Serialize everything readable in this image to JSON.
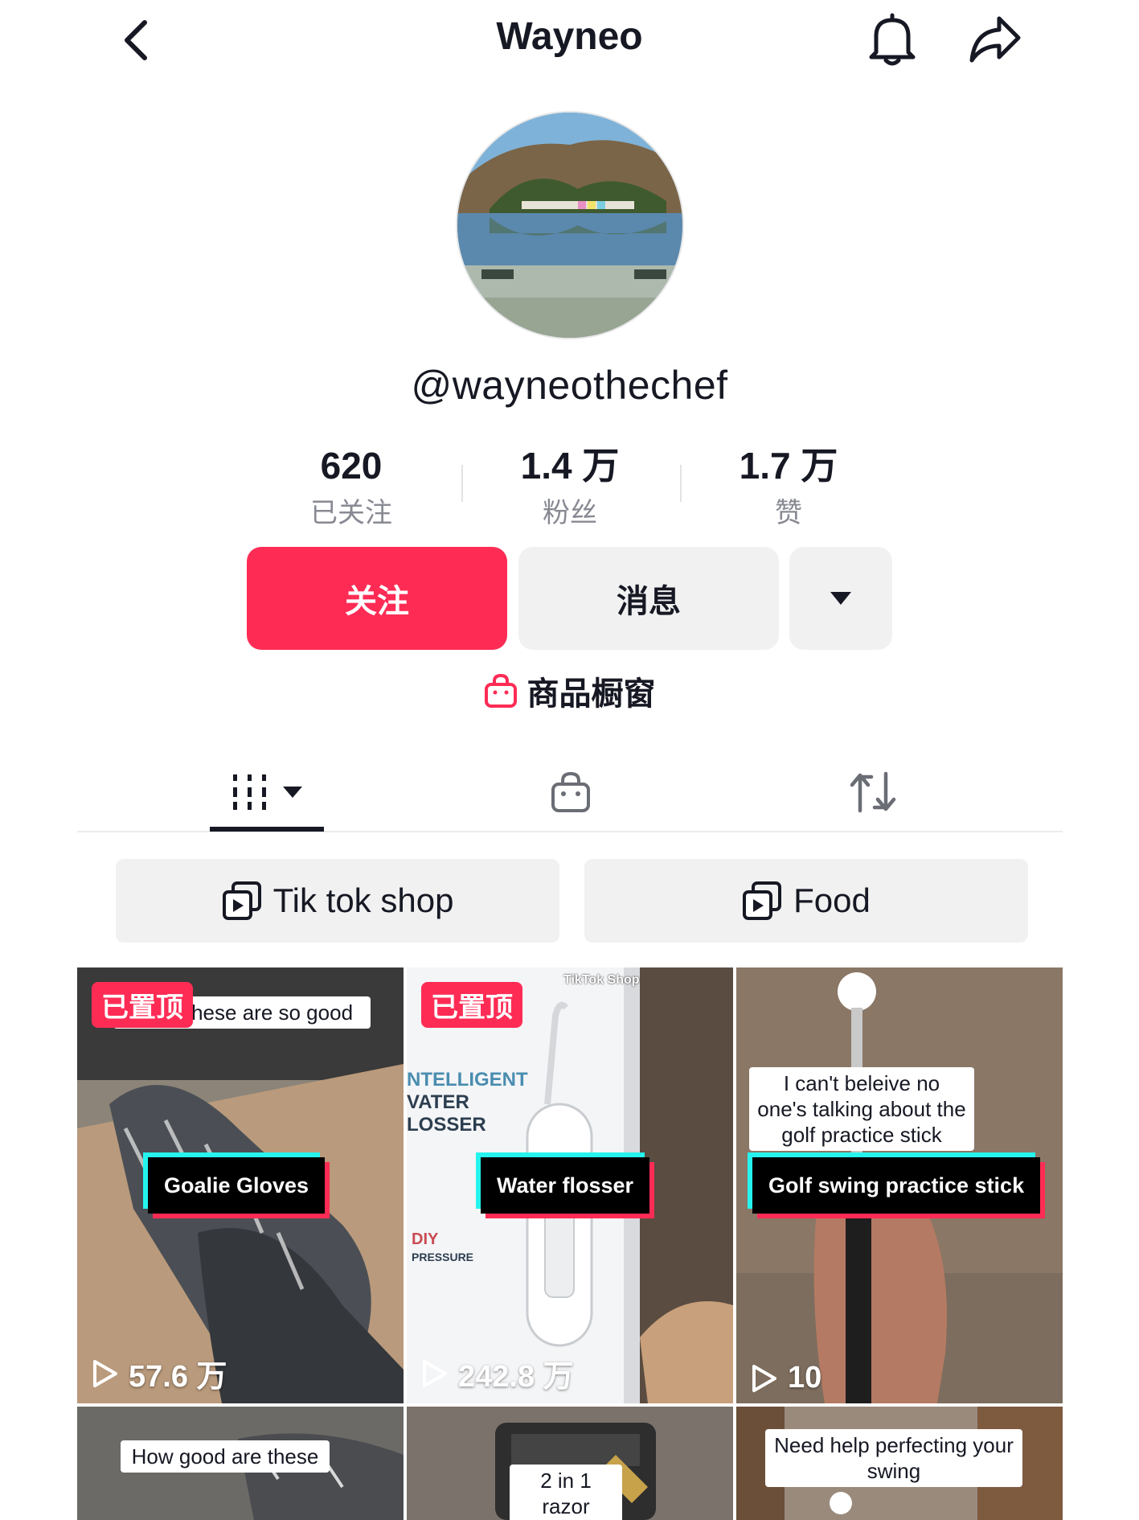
{
  "header": {
    "title": "Wayneo",
    "back_icon": "chevron-left-icon",
    "bell_icon": "bell-icon",
    "share_icon": "share-icon"
  },
  "profile": {
    "handle": "@wayneothechef",
    "stats": [
      {
        "value": "620",
        "label": "已关注"
      },
      {
        "value": "1.4 万",
        "label": "粉丝"
      },
      {
        "value": "1.7 万",
        "label": "赞"
      }
    ]
  },
  "actions": {
    "follow_label": "关注",
    "message_label": "消息"
  },
  "showcase": {
    "label": "商品橱窗"
  },
  "tabs": [
    {
      "name": "videos",
      "icon": "grid-icon",
      "active": true
    },
    {
      "name": "shop",
      "icon": "bag-icon",
      "active": false
    },
    {
      "name": "reposts",
      "icon": "repost-icon",
      "active": false
    }
  ],
  "playlists": [
    {
      "label": "Tik tok shop"
    },
    {
      "label": "Food"
    }
  ],
  "videos": [
    {
      "pinned_label": "已置顶",
      "caption_top": "loves these are so good",
      "title": "Goalie Gloves",
      "views": "57.6 万"
    },
    {
      "pinned_label": "已置顶",
      "overlay_brand": "TikTok Shop",
      "box_text_1": "NTELLIGENT",
      "box_text_2": "VATER",
      "box_text_3": "LOSSER",
      "box_text_4": "DIY",
      "box_text_5": "PRESSURE",
      "title": "Water flosser",
      "views": "242.8 万"
    },
    {
      "caption_top": "I can't beleive no one's talking about the golf practice stick",
      "title": "Golf swing practice stick",
      "views": "10"
    },
    {
      "caption_top": "How good are these"
    },
    {
      "caption_top": "2 in 1 razor"
    },
    {
      "caption_top": "Need help perfecting your swing"
    }
  ],
  "colors": {
    "accent": "#fe2c55",
    "cyan": "#25f4ee",
    "text": "#161823",
    "muted": "#888a93",
    "button_bg": "#f1f1f2"
  }
}
